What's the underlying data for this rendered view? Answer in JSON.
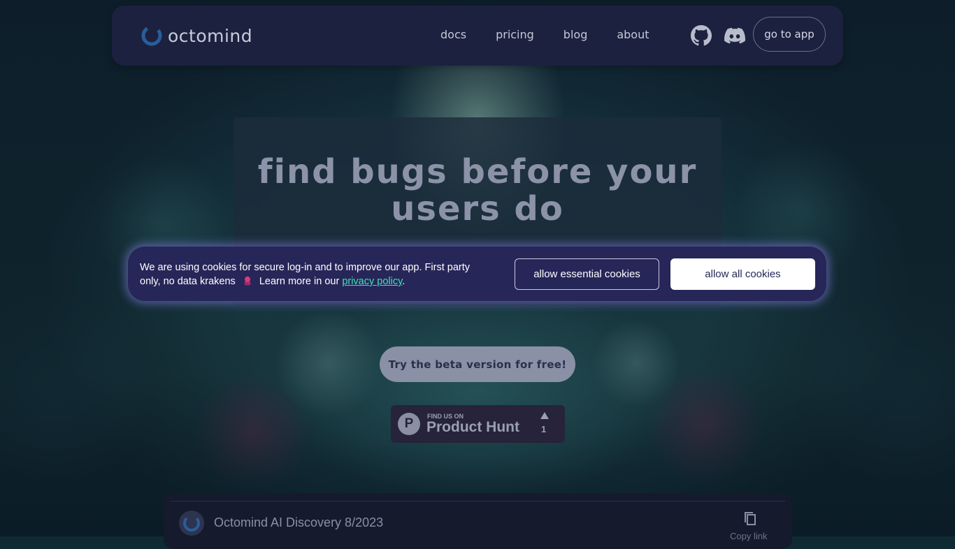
{
  "header": {
    "brand": "octomind",
    "nav": [
      {
        "label": "docs"
      },
      {
        "label": "pricing"
      },
      {
        "label": "blog"
      },
      {
        "label": "about"
      }
    ],
    "social_icons": [
      "github-icon",
      "discord-icon"
    ],
    "cta_label": "go to app"
  },
  "hero": {
    "title": "find bugs before your users do"
  },
  "cookie_banner": {
    "text_before": "We are using cookies for secure log-in and to improve our app.  First party only, no data krakens",
    "text_after": "Learn more in our",
    "link_label": "privacy policy",
    "period": ".",
    "essential_label": "allow essential cookies",
    "all_label": "allow all cookies"
  },
  "beta_button": {
    "label": "Try the beta version for free!"
  },
  "product_hunt": {
    "logo_letter": "P",
    "find_us": "FIND US ON",
    "name": "Product Hunt",
    "count": "1"
  },
  "video": {
    "title": "Octomind AI Discovery 8/2023",
    "copy_label": "Copy link"
  },
  "colors": {
    "header_bg": "#1c2140",
    "cookie_bg": "#272659",
    "link": "#3ee3b5",
    "hero_text": "#8c93a8"
  }
}
